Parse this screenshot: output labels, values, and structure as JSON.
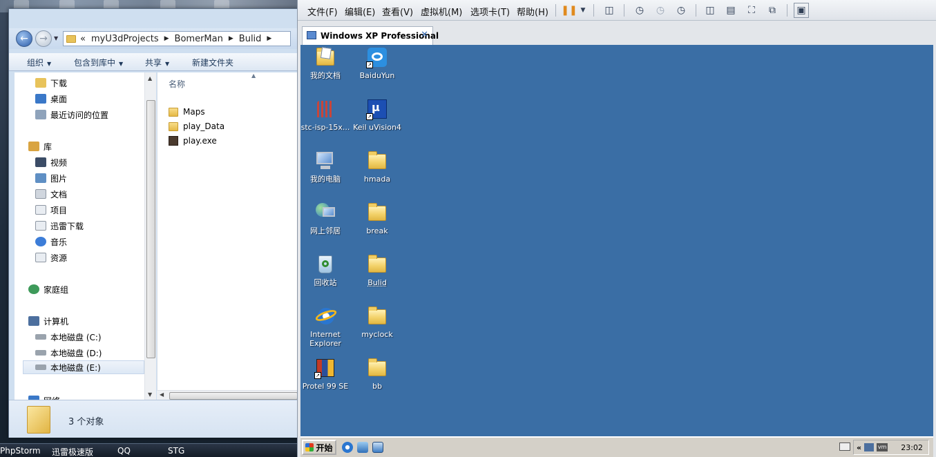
{
  "host": {
    "taskbar": [
      "PhpStorm",
      "迅雷极速版",
      "QQ",
      "STG"
    ]
  },
  "explorer": {
    "breadcrumbs": [
      "«",
      "myU3dProjects",
      "BomerMan",
      "Bulid"
    ],
    "toolbar": {
      "organize": "组织",
      "include_in_library": "包含到库中",
      "share": "共享",
      "new_folder": "新建文件夹"
    },
    "nav": [
      {
        "label": "下载",
        "icon": "download-folder-icon",
        "color": "#e8c35b"
      },
      {
        "label": "桌面",
        "icon": "desktop-icon",
        "color": "#3a78c8"
      },
      {
        "label": "最近访问的位置",
        "icon": "recent-places-icon",
        "color": "#8fa3bb"
      },
      {
        "label": "库",
        "icon": "library-icon",
        "color": "#d9a441"
      },
      {
        "label": "视频",
        "icon": "video-icon",
        "color": "#3b4c66"
      },
      {
        "label": "图片",
        "icon": "pictures-icon",
        "color": "#5f8fc4"
      },
      {
        "label": "文档",
        "icon": "documents-icon",
        "color": "#d0d6de"
      },
      {
        "label": "项目",
        "icon": "project-icon",
        "color": "#c7ced8"
      },
      {
        "label": "迅雷下载",
        "icon": "thunder-download-icon",
        "color": "#c7ced8"
      },
      {
        "label": "音乐",
        "icon": "music-icon",
        "color": "#3c7dd8"
      },
      {
        "label": "资源",
        "icon": "resources-icon",
        "color": "#c7ced8"
      },
      {
        "label": "家庭组",
        "icon": "homegroup-icon",
        "color": "#3e9a5a"
      },
      {
        "label": "计算机",
        "icon": "computer-icon",
        "color": "#4c6f9e"
      },
      {
        "label": "本地磁盘 (C:)",
        "icon": "disk-c-icon",
        "color": "#9aa3ad"
      },
      {
        "label": "本地磁盘 (D:)",
        "icon": "disk-d-icon",
        "color": "#9aa3ad"
      },
      {
        "label": "本地磁盘 (E:)",
        "icon": "disk-e-icon",
        "color": "#9aa3ad"
      },
      {
        "label": "网络",
        "icon": "network-icon",
        "color": "#3a78c8"
      }
    ],
    "column_header": "名称",
    "files": [
      {
        "name": "Maps",
        "type": "folder"
      },
      {
        "name": "play_Data",
        "type": "folder"
      },
      {
        "name": "play.exe",
        "type": "exe"
      }
    ],
    "status": "3 个对象"
  },
  "vmware": {
    "menu": [
      "文件(F)",
      "编辑(E)",
      "查看(V)",
      "虚拟机(M)",
      "选项卡(T)",
      "帮助(H)"
    ],
    "tab_title": "Windows XP Professional",
    "desktop_icons": [
      {
        "label": "我的文档",
        "icon": "my-documents-icon",
        "shortcut": false
      },
      {
        "label": "BaiduYun",
        "icon": "baiduyun-icon",
        "shortcut": true
      },
      {
        "label": "stc-isp-15x...",
        "icon": "stc-isp-icon",
        "shortcut": false
      },
      {
        "label": "Keil uVision4",
        "icon": "keil-icon",
        "shortcut": true
      },
      {
        "label": "我的电脑",
        "icon": "my-computer-icon",
        "shortcut": false
      },
      {
        "label": "hmada",
        "icon": "folder-icon",
        "shortcut": false
      },
      {
        "label": "网上邻居",
        "icon": "network-places-icon",
        "shortcut": false
      },
      {
        "label": "break",
        "icon": "folder-icon",
        "shortcut": false
      },
      {
        "label": "回收站",
        "icon": "recycle-bin-icon",
        "shortcut": false
      },
      {
        "label": "Bulid",
        "icon": "folder-icon",
        "shortcut": false
      },
      {
        "label": "Internet Explorer",
        "icon": "internet-explorer-icon",
        "shortcut": false
      },
      {
        "label": "myclock",
        "icon": "folder-icon",
        "shortcut": false
      },
      {
        "label": "Protel 99 SE",
        "icon": "protel-icon",
        "shortcut": true
      },
      {
        "label": "bb",
        "icon": "folder-icon",
        "shortcut": false
      }
    ],
    "xp_taskbar": {
      "start": "开始",
      "tray_chevron": "«",
      "clock": "23:02"
    },
    "colors": {
      "xp_desktop": "#3a6ea5",
      "xp_taskbar": "#d4d0c8"
    }
  }
}
